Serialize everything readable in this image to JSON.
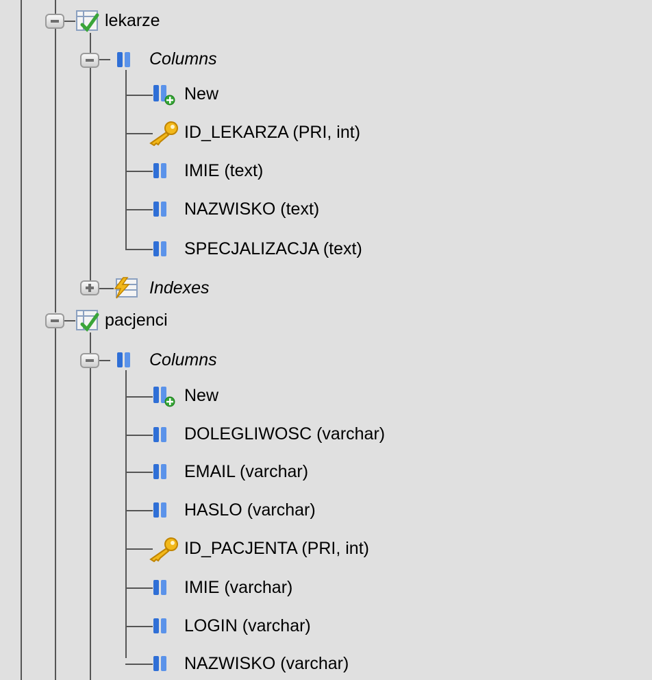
{
  "tables": [
    {
      "name": "lekarze",
      "columns_label": "Columns",
      "new_label": "New",
      "columns": [
        {
          "text": "ID_LEKARZA (PRI, int)",
          "icon": "primary-key-icon"
        },
        {
          "text": "IMIE (text)",
          "icon": "column-icon"
        },
        {
          "text": "NAZWISKO (text)",
          "icon": "column-icon"
        },
        {
          "text": "SPECJALIZACJA (text)",
          "icon": "column-icon"
        }
      ],
      "indexes_label": "Indexes"
    },
    {
      "name": "pacjenci",
      "columns_label": "Columns",
      "new_label": "New",
      "columns": [
        {
          "text": "DOLEGLIWOSC (varchar)",
          "icon": "column-icon"
        },
        {
          "text": "EMAIL (varchar)",
          "icon": "column-icon"
        },
        {
          "text": "HASLO (varchar)",
          "icon": "column-icon"
        },
        {
          "text": "ID_PACJENTA (PRI, int)",
          "icon": "primary-key-icon"
        },
        {
          "text": "IMIE (varchar)",
          "icon": "column-icon"
        },
        {
          "text": "LOGIN (varchar)",
          "icon": "column-icon"
        },
        {
          "text": "NAZWISKO (varchar)",
          "icon": "column-icon"
        }
      ]
    }
  ],
  "colors": {
    "background": "#e0e0e0",
    "tree_line": "#555555",
    "column_icon": "#2f6fd6",
    "key_icon": "#e0a100",
    "table_icon_check": "#3aa53a"
  }
}
